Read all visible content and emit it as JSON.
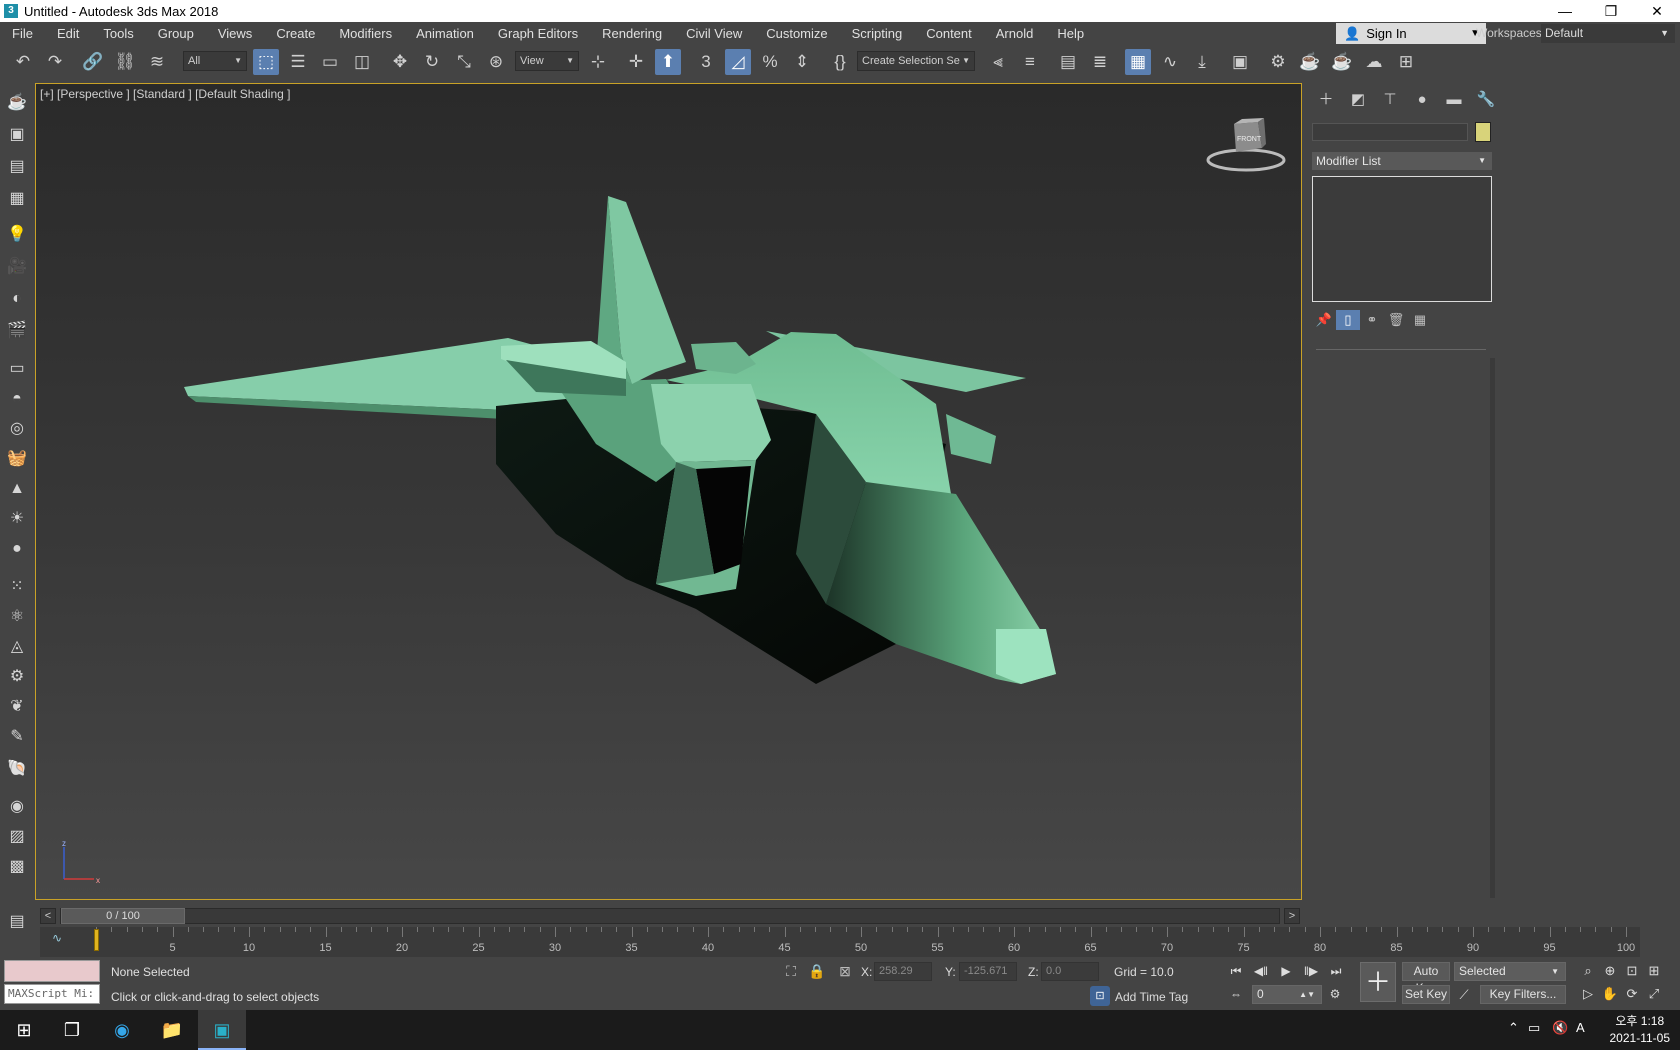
{
  "window": {
    "title": "Untitled - Autodesk 3ds Max 2018",
    "app_icon": "3",
    "controls": [
      "—",
      "❐",
      "✕"
    ]
  },
  "menu": {
    "items": [
      "File",
      "Edit",
      "Tools",
      "Group",
      "Views",
      "Create",
      "Modifiers",
      "Animation",
      "Graph Editors",
      "Rendering",
      "Civil View",
      "Customize",
      "Scripting",
      "Content",
      "Arnold",
      "Help"
    ],
    "sign_in": "Sign In",
    "workspaces_label": "Workspaces:",
    "workspaces_value": "Default"
  },
  "toolbar": {
    "selection_filter": "All",
    "ref_coord": "View",
    "named_selection": "Create Selection Se",
    "snap_label": "3",
    "angle_snap_label": "◿",
    "percent_snap_label": "%"
  },
  "viewport": {
    "label": "[+] [Perspective ] [Standard ] [Default Shading ]",
    "viewcube_face": "FRONT",
    "axis_z": "z",
    "axis_x": "x"
  },
  "command_panel": {
    "modifier_list": "Modifier List"
  },
  "time_slider": {
    "prev": "<",
    "next": ">",
    "frame_display": "0 / 100"
  },
  "track_bar": {
    "ticks": [
      "5",
      "10",
      "15",
      "20",
      "25",
      "30",
      "35",
      "40",
      "45",
      "50",
      "55",
      "60",
      "65",
      "70",
      "75",
      "80",
      "85",
      "90",
      "95",
      "100"
    ],
    "curve_icon": "∿"
  },
  "status": {
    "maxscript": "MAXScript Mi:",
    "selection": "None Selected",
    "prompt": "Click or click-and-drag to select objects",
    "x_label": "X:",
    "x_value": "258.29",
    "y_label": "Y:",
    "y_value": "-125.671",
    "z_label": "Z:",
    "z_value": "0.0",
    "grid": "Grid = 10.0",
    "add_time_tag": "Add Time Tag",
    "auto_key": "Auto Key",
    "set_key": "Set Key",
    "key_mode": "Selected",
    "frame_spinner": "0",
    "key_filters": "Key Filters..."
  },
  "taskbar": {
    "clock_time": "오후 1:18",
    "clock_date": "2021-11-05",
    "ime": "A"
  },
  "colors": {
    "accent": "#5b7fb0",
    "viewport_border": "#c9a227",
    "model": "#7fc7a0",
    "object_color": "#d8d37a"
  }
}
